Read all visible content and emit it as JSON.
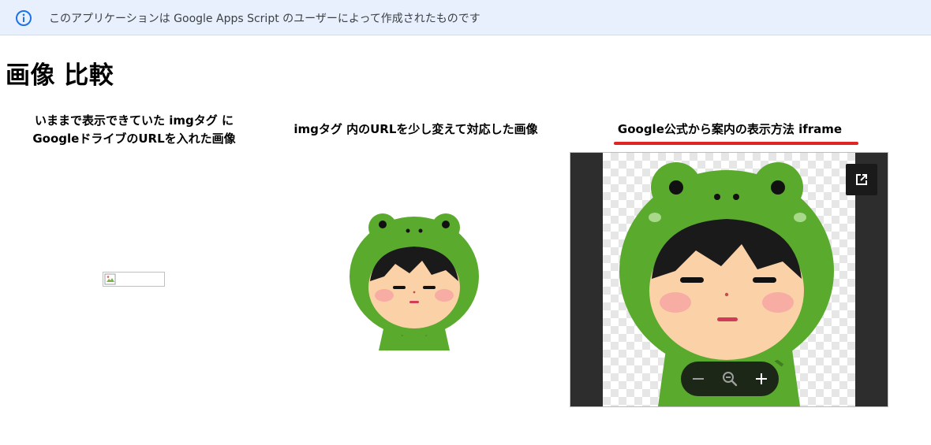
{
  "banner": {
    "message": "このアプリケーションは Google Apps Script のユーザーによって作成されたものです",
    "icon": "info-icon"
  },
  "page": {
    "title": "画像 比較"
  },
  "columns": [
    {
      "title_line1": "いままで表示できていた imgタグ に",
      "title_line2": "GoogleドライブのURLを入れた画像"
    },
    {
      "title": "imgタグ 内のURLを少し変えて対応した画像"
    },
    {
      "title": "Google公式から案内の表示方法 iframe"
    }
  ],
  "colors": {
    "banner_bg": "#e8f0fe",
    "info_blue": "#1a73e8",
    "underline_red": "#e02424",
    "frog_green": "#5aaa2e",
    "viewer_dark": "#2d2d2d"
  },
  "viewer": {
    "popout_icon": "open-in-new-icon",
    "zoom_controls": [
      "zoom-out-icon",
      "zoom-reset-icon",
      "zoom-in-icon"
    ]
  }
}
